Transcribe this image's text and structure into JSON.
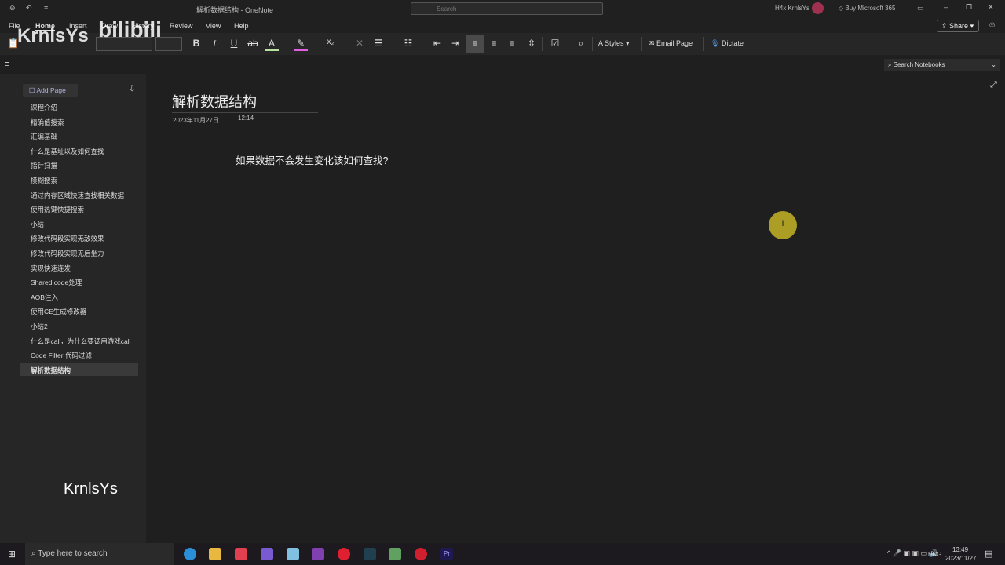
{
  "window": {
    "title": "解析数据结构 - OneNote",
    "search_placeholder": "Search",
    "user": "H4x KrnlsYs",
    "buy": "Buy Microsoft 365"
  },
  "menu": [
    "File",
    "Home",
    "Insert",
    "Draw",
    "History",
    "Review",
    "View",
    "Help"
  ],
  "ribbon": {
    "styles": "Styles",
    "email": "Email Page",
    "dictate": "Dictate",
    "share": "Share"
  },
  "search_notebooks": "Search Notebooks",
  "sidebar": {
    "add_page": "Add Page",
    "pages": [
      "课程介绍",
      "精确值搜索",
      "汇编基础",
      "什么是基址以及如何查找",
      "指针扫描",
      "模糊搜索",
      "通过内存区域快速查找相关数据",
      "使用热键快捷搜索",
      "小结",
      "修改代码段实现无敌效果",
      "修改代码段实现无后坐力",
      "实现快速连发",
      "Shared code处理",
      "AOB注入",
      "使用CE生成修改器",
      "小结2",
      "什么是call，为什么要调用游戏call",
      "Code Filter 代码过滤",
      "解析数据结构"
    ],
    "selected": 18
  },
  "page": {
    "title": "解析数据结构",
    "date": "2023年11月27日",
    "time": "12:14",
    "body": "如果数据不会发生变化该如何查找?"
  },
  "watermark": {
    "left": "KrnlsYs",
    "logo": "bilibili",
    "bottom": "KrnlsYs"
  },
  "taskbar": {
    "search": "Type here to search",
    "lang": "ENG",
    "time": "13:49",
    "date": "2023/11/27"
  }
}
